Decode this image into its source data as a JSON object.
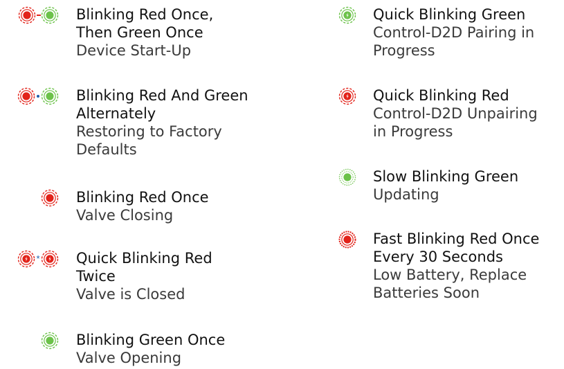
{
  "colors": {
    "red": "#e2231a",
    "green": "#6cc24a",
    "blue": "#1f5fae"
  },
  "left_column": [
    {
      "title": "Blinking Red Once,\nThen Green Once",
      "desc": "Device Start-Up",
      "icons": [
        "led-red-icon",
        "dash-separator",
        "led-green-icon"
      ]
    },
    {
      "title": "Blinking Red And Green\nAlternately",
      "desc": "Restoring to Factory\nDefaults",
      "icons": [
        "led-red-icon",
        "dot-separator",
        "led-green-icon"
      ]
    },
    {
      "title": "Blinking Red Once",
      "desc": "Valve Closing",
      "icons": [
        "led-red-icon"
      ]
    },
    {
      "title": "Quick Blinking Red\nTwice",
      "desc": "Valve is Closed",
      "icons": [
        "led-red-quick-icon",
        "asterisk-separator",
        "led-red-quick-icon"
      ]
    },
    {
      "title": "Blinking Green Once",
      "desc": "Valve Opening",
      "icons": [
        "led-green-icon"
      ]
    }
  ],
  "right_column": [
    {
      "title": "Quick Blinking Green",
      "desc": "Control-D2D Pairing in\nProgress",
      "icons": [
        "led-green-quick-icon"
      ]
    },
    {
      "title": "Quick Blinking Red",
      "desc": "Control-D2D Unpairing\nin Progress",
      "icons": [
        "led-red-quick-icon"
      ]
    },
    {
      "title": "Slow Blinking Green",
      "desc": "Updating",
      "icons": [
        "led-green-slow-icon"
      ]
    },
    {
      "title": "Fast Blinking Red Once\nEvery 30 Seconds",
      "desc": "Low Battery, Replace\nBatteries Soon",
      "icons": [
        "led-red-fast-icon"
      ]
    }
  ]
}
